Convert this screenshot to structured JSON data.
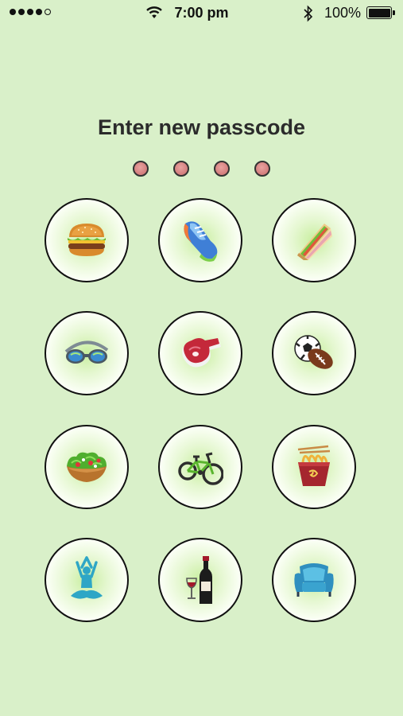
{
  "status_bar": {
    "time": "7:00 pm",
    "battery_percent": "100%",
    "signal_bars": 4,
    "signal_total": 5,
    "battery_level": 1.0
  },
  "title": "Enter new passcode",
  "passcode": {
    "slots": 4,
    "entered": 0
  },
  "keys": [
    {
      "icon": "burger-icon"
    },
    {
      "icon": "running-shoe-icon"
    },
    {
      "icon": "sandwich-icon"
    },
    {
      "icon": "swim-goggles-icon"
    },
    {
      "icon": "steak-icon"
    },
    {
      "icon": "soccer-football-icon"
    },
    {
      "icon": "salad-icon"
    },
    {
      "icon": "bicycle-icon"
    },
    {
      "icon": "noodles-box-icon"
    },
    {
      "icon": "yoga-icon"
    },
    {
      "icon": "wine-icon"
    },
    {
      "icon": "armchair-icon"
    }
  ],
  "colors": {
    "background": "#d9f0c9",
    "key_glow": "#c8ee9f",
    "pin_dot": "#d07a78"
  }
}
